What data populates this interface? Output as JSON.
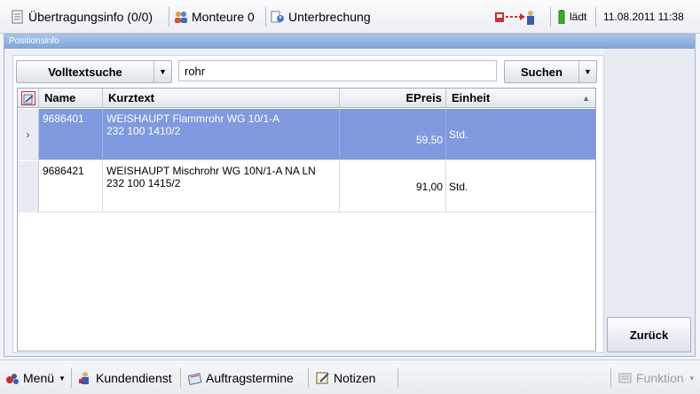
{
  "topbar": {
    "transfer_info": "Übertragungsinfo (0/0)",
    "fitters": "Monteure 0",
    "interruption": "Unterbrechung",
    "battery_status": "lädt",
    "datetime": "11.08.2011 11:38"
  },
  "panel": {
    "title": "Positionsinfo"
  },
  "search": {
    "mode_label": "Volltextsuche",
    "query": "rohr",
    "search_button": "Suchen"
  },
  "grid": {
    "columns": [
      "Name",
      "Kurztext",
      "EPreis",
      "Einheit"
    ],
    "rows": [
      {
        "name": "9686401",
        "kurztext_line1": "WEISHAUPT Flammrohr WG 10/1-A",
        "kurztext_line2": "232 100 1410/2",
        "epreis": "59,50",
        "einheit": "Std.",
        "selected": true
      },
      {
        "name": "9686421",
        "kurztext_line1": "WEISHAUPT Mischrohr WG 10N/1-A NA LN",
        "kurztext_line2": "232 100 1415/2",
        "epreis": "91,00",
        "einheit": "Std.",
        "selected": false
      }
    ]
  },
  "side": {
    "back_button": "Zurück"
  },
  "bottombar": {
    "menu": "Menü",
    "customer_service": "Kundendienst",
    "order_dates": "Auftragstermine",
    "notes": "Notizen",
    "function": "Funktion"
  },
  "colors": {
    "selected_row": "#7f9ade",
    "panel_header": "#7ea4d8"
  }
}
